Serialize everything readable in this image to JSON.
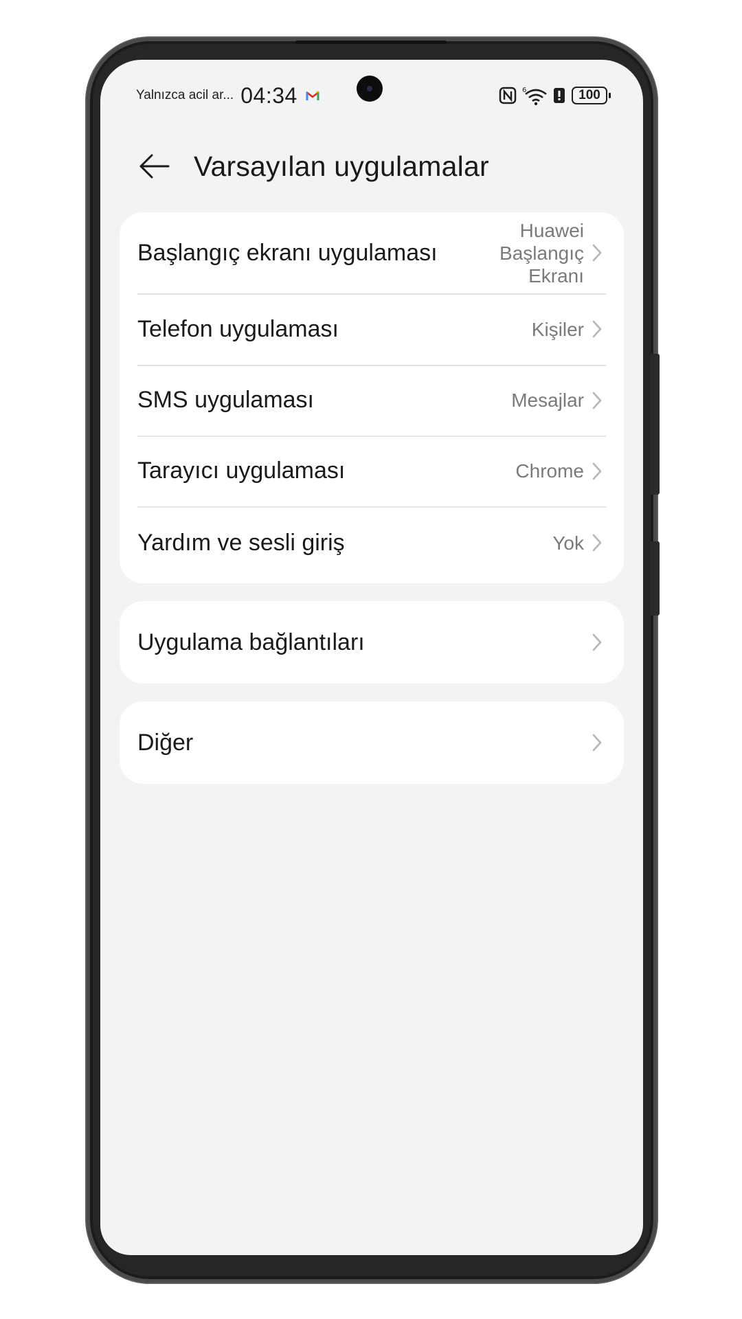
{
  "status_bar": {
    "notice": "Yalnızca acil ar...",
    "time": "04:34",
    "notification_icon": "gmail-icon",
    "battery_level": "100",
    "icons": [
      "nfc-icon",
      "wifi-6-icon",
      "battery-saver-icon",
      "battery-icon"
    ]
  },
  "header": {
    "back_icon": "arrow-left-icon",
    "title": "Varsayılan uygulamalar"
  },
  "default_apps": [
    {
      "label": "Başlangıç ekranı uygulaması",
      "value_lines": [
        "Huawei",
        "Başlangıç",
        "Ekranı"
      ]
    },
    {
      "label": "Telefon uygulaması",
      "value": "Kişiler"
    },
    {
      "label": "SMS uygulaması",
      "value": "Mesajlar"
    },
    {
      "label": "Tarayıcı uygulaması",
      "value": "Chrome"
    },
    {
      "label": "Yardım ve sesli giriş",
      "value": "Yok"
    }
  ],
  "app_links": {
    "label": "Uygulama bağlantıları"
  },
  "other": {
    "label": "Diğer"
  },
  "colors": {
    "screen_background": "#f1f3f5",
    "card_background": "#ffffff",
    "primary_text": "#1a1a1a",
    "secondary_text": "#7a7a7a"
  }
}
